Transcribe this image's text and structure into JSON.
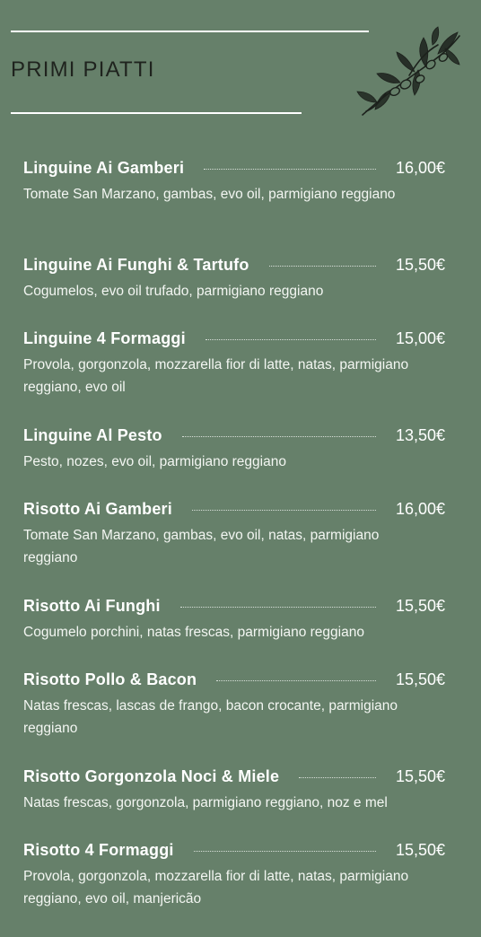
{
  "section": {
    "title": "PRIMI PIATTI",
    "decoration_icon": "olive-branch-icon"
  },
  "colors": {
    "background": "#66806a",
    "title": "#1f231e",
    "text": "#ffffff"
  },
  "items": [
    {
      "name": "Linguine Ai Gamberi",
      "price": "16,00€",
      "description": "Tomate San Marzano, gambas, evo oil, parmigiano reggiano"
    },
    {
      "name": "Linguine Ai Funghi & Tartufo",
      "price": "15,50€",
      "description": "Cogumelos, evo oil trufado, parmigiano reggiano"
    },
    {
      "name": "Linguine 4 Formaggi",
      "price": "15,00€",
      "description": "Provola, gorgonzola, mozzarella fior di latte, natas, parmigiano reggiano, evo oil"
    },
    {
      "name": "Linguine Al Pesto",
      "price": "13,50€",
      "description": "Pesto, nozes, evo oil, parmigiano reggiano"
    },
    {
      "name": "Risotto Ai Gamberi",
      "price": "16,00€",
      "description": "Tomate San Marzano, gambas, evo oil, natas, parmigiano reggiano"
    },
    {
      "name": "Risotto Ai Funghi",
      "price": "15,50€",
      "description": "Cogumelo porchini, natas frescas, parmigiano reggiano"
    },
    {
      "name": "Risotto Pollo & Bacon",
      "price": "15,50€",
      "description": "Natas frescas, lascas de frango, bacon crocante, parmigiano reggiano"
    },
    {
      "name": "Risotto Gorgonzola Noci & Miele",
      "price": "15,50€",
      "description": "Natas frescas, gorgonzola, parmigiano reggiano, noz e mel"
    },
    {
      "name": "Risotto 4 Formaggi",
      "price": "15,50€",
      "description": "Provola, gorgonzola, mozzarella fior di latte, natas, parmigiano reggiano, evo oil, manjericão"
    }
  ]
}
